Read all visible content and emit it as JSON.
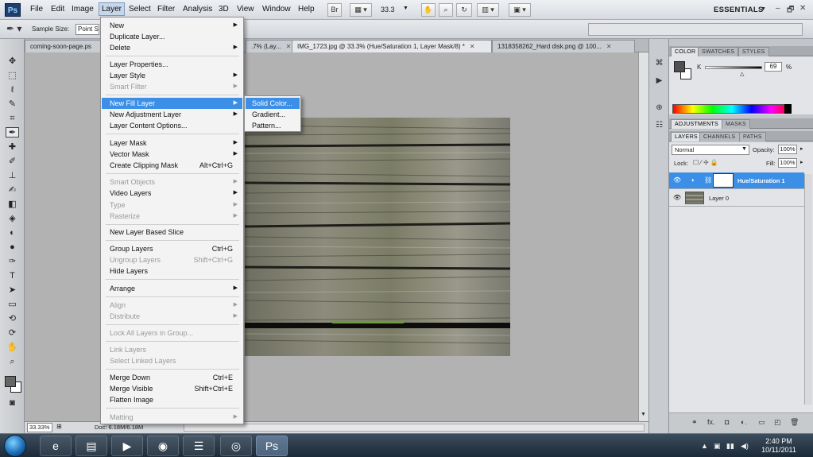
{
  "app": {
    "logo": "Ps",
    "menus": [
      "File",
      "Edit",
      "Image",
      "Layer",
      "Select",
      "Filter",
      "Analysis",
      "3D",
      "View",
      "Window",
      "Help"
    ],
    "zoom_level": "33.3",
    "workspace": "ESSENTIALS",
    "workspace_arrow": "▼",
    "win_controls": [
      "–",
      "🗗"
    ]
  },
  "options_bar": {
    "sample_size_label": "Sample Size:",
    "sample_size_value": "Point S"
  },
  "doc_tabs": [
    {
      "label": "coming-soon-page.ps"
    },
    {
      "label": ".7% (Lay..."
    },
    {
      "label": "IMG_1723.jpg @ 33.3% (Hue/Saturation 1, Layer Mask/8) *"
    },
    {
      "label": "1318358262_Hard disk.png @ 100..."
    }
  ],
  "status": {
    "zoom": "33.33%",
    "doc_size": "Doc: 6.18M/6.18M"
  },
  "layer_menu": {
    "items": [
      {
        "label": "New",
        "shortcut": "",
        "submenu": true,
        "disabled": false
      },
      {
        "label": "Duplicate Layer...",
        "shortcut": "",
        "submenu": false,
        "disabled": false
      },
      {
        "label": "Delete",
        "shortcut": "",
        "submenu": true,
        "disabled": false
      },
      {
        "label": "Layer Properties...",
        "shortcut": "",
        "submenu": false,
        "disabled": false
      },
      {
        "label": "Layer Style",
        "shortcut": "",
        "submenu": true,
        "disabled": false
      },
      {
        "label": "Smart Filter",
        "shortcut": "",
        "submenu": true,
        "disabled": true
      },
      {
        "label": "New Fill Layer",
        "shortcut": "",
        "submenu": true,
        "disabled": false,
        "highlighted": true
      },
      {
        "label": "New Adjustment Layer",
        "shortcut": "",
        "submenu": true,
        "disabled": false
      },
      {
        "label": "Layer Content Options...",
        "shortcut": "",
        "submenu": false,
        "disabled": false
      },
      {
        "label": "Layer Mask",
        "shortcut": "",
        "submenu": true,
        "disabled": false
      },
      {
        "label": "Vector Mask",
        "shortcut": "",
        "submenu": true,
        "disabled": false
      },
      {
        "label": "Create Clipping Mask",
        "shortcut": "Alt+Ctrl+G",
        "submenu": false,
        "disabled": false
      },
      {
        "label": "Smart Objects",
        "shortcut": "",
        "submenu": true,
        "disabled": true
      },
      {
        "label": "Video Layers",
        "shortcut": "",
        "submenu": true,
        "disabled": false
      },
      {
        "label": "Type",
        "shortcut": "",
        "submenu": true,
        "disabled": true
      },
      {
        "label": "Rasterize",
        "shortcut": "",
        "submenu": true,
        "disabled": true
      },
      {
        "label": "New Layer Based Slice",
        "shortcut": "",
        "submenu": false,
        "disabled": false
      },
      {
        "label": "Group Layers",
        "shortcut": "Ctrl+G",
        "submenu": false,
        "disabled": false
      },
      {
        "label": "Ungroup Layers",
        "shortcut": "Shift+Ctrl+G",
        "submenu": false,
        "disabled": true
      },
      {
        "label": "Hide Layers",
        "shortcut": "",
        "submenu": false,
        "disabled": false
      },
      {
        "label": "Arrange",
        "shortcut": "",
        "submenu": true,
        "disabled": false
      },
      {
        "label": "Align",
        "shortcut": "",
        "submenu": true,
        "disabled": true
      },
      {
        "label": "Distribute",
        "shortcut": "",
        "submenu": true,
        "disabled": true
      },
      {
        "label": "Lock All Layers in Group...",
        "shortcut": "",
        "submenu": false,
        "disabled": true
      },
      {
        "label": "Link Layers",
        "shortcut": "",
        "submenu": false,
        "disabled": true
      },
      {
        "label": "Select Linked Layers",
        "shortcut": "",
        "submenu": false,
        "disabled": true
      },
      {
        "label": "Merge Down",
        "shortcut": "Ctrl+E",
        "submenu": false,
        "disabled": false
      },
      {
        "label": "Merge Visible",
        "shortcut": "Shift+Ctrl+E",
        "submenu": false,
        "disabled": false
      },
      {
        "label": "Flatten Image",
        "shortcut": "",
        "submenu": false,
        "disabled": false
      },
      {
        "label": "Matting",
        "shortcut": "",
        "submenu": true,
        "disabled": true
      }
    ]
  },
  "fill_submenu": {
    "items": [
      {
        "label": "Solid Color...",
        "highlighted": true
      },
      {
        "label": "Gradient...",
        "highlighted": false
      },
      {
        "label": "Pattern...",
        "highlighted": false
      }
    ]
  },
  "color_panel": {
    "tabs": [
      "COLOR",
      "SWATCHES",
      "STYLES"
    ],
    "channel": "K",
    "value": "69",
    "unit": "%",
    "foreground": "#505050",
    "background": "#ffffff"
  },
  "adjustments_panel": {
    "tabs": [
      "ADJUSTMENTS",
      "MASKS"
    ]
  },
  "layers_panel": {
    "tabs": [
      "LAYERS",
      "CHANNELS",
      "PATHS"
    ],
    "blend_mode": "Normal",
    "opacity_label": "Opacity:",
    "opacity": "100%",
    "lock_label": "Lock:",
    "fill_label": "Fill:",
    "fill": "100%",
    "layers": [
      {
        "name": "Hue/Saturation 1",
        "selected": true
      },
      {
        "name": "Layer 0",
        "selected": false
      }
    ]
  },
  "taskbar": {
    "time": "2:40 PM",
    "date": "10/11/2011"
  },
  "colors": {
    "menu_highlight": "#3b8fe6",
    "photoshop_blue": "#1c3f6e"
  }
}
